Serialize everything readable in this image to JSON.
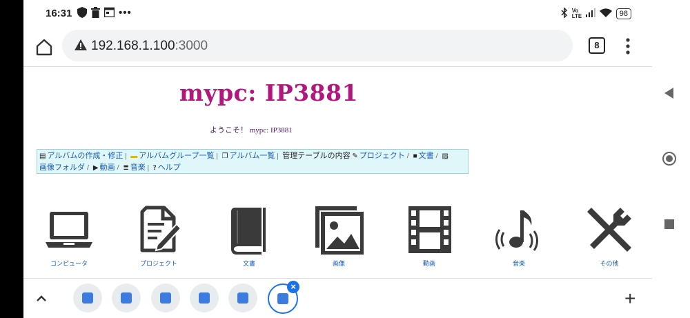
{
  "status": {
    "time": "16:31",
    "battery": "98",
    "network": "Vo LTE",
    "icons_left": [
      "shield-icon",
      "trash-icon",
      "calendar-icon",
      "more-dots-icon"
    ],
    "icons_right": [
      "bluetooth-icon",
      "signal-icon",
      "wifi-icon",
      "battery-icon"
    ]
  },
  "browser": {
    "url_host": "192.168.1.100",
    "url_port": ":3000",
    "tab_count": "8"
  },
  "page": {
    "title": "mypc: IP3881",
    "welcome": "ようこそ！ mypc: IP3881",
    "menu": [
      {
        "label": "アルバムの作成・修正",
        "link": true
      },
      {
        "label": "アルバムグループ一覧",
        "link": true
      },
      {
        "label": "アルバム一覧",
        "link": true
      },
      {
        "label": "管理テーブルの内容",
        "link": false
      },
      {
        "label": "プロジェクト",
        "link": true
      },
      {
        "label": "文書",
        "link": true
      },
      {
        "label": "画像フォルダ",
        "link": true
      },
      {
        "label": "動画",
        "link": true
      },
      {
        "label": "音楽",
        "link": true
      },
      {
        "label": "ヘルプ",
        "link": true
      }
    ],
    "tiles": [
      {
        "label": "コンピュータ",
        "icon": "laptop-icon"
      },
      {
        "label": "プロジェクト",
        "icon": "document-edit-icon"
      },
      {
        "label": "文書",
        "icon": "book-icon"
      },
      {
        "label": "画像",
        "icon": "images-icon"
      },
      {
        "label": "動画",
        "icon": "film-icon"
      },
      {
        "label": "音楽",
        "icon": "music-icon"
      },
      {
        "label": "その他",
        "icon": "tools-icon"
      }
    ]
  },
  "tabstrip": {
    "tab_count": 6,
    "active_index": 5
  },
  "colors": {
    "title": "#b0187e",
    "welcome": "#51186e",
    "menu_bg": "#dff7f8",
    "link": "#1a5bb5",
    "icon": "#3a3a3a",
    "accent": "#1a73e8"
  }
}
